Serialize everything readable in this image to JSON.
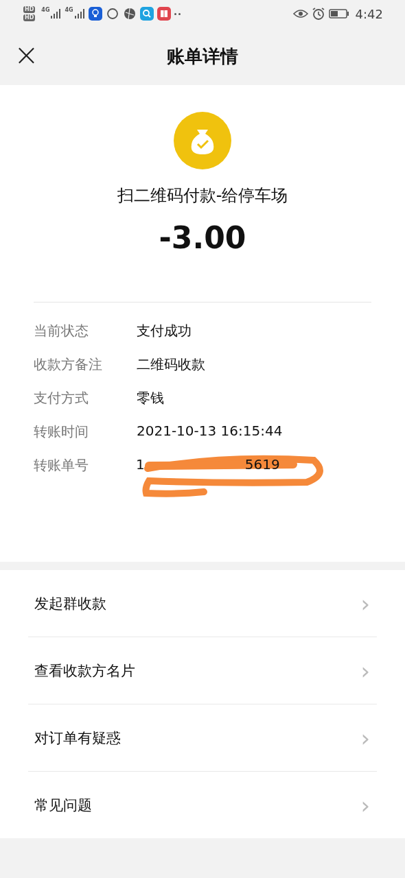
{
  "status_bar": {
    "sim_labels": [
      "HD",
      "HD"
    ],
    "network_labels": [
      "4G",
      "4G"
    ],
    "time": "4:42"
  },
  "header": {
    "close": "×",
    "title": "账单详情"
  },
  "payment": {
    "title": "扫二维码付款-给停车场",
    "amount": "-3.00"
  },
  "details": [
    {
      "label": "当前状态",
      "value": "支付成功"
    },
    {
      "label": "收款方备注",
      "value": "二维码收款"
    },
    {
      "label": "支付方式",
      "value": "零钱"
    },
    {
      "label": "转账时间",
      "value": "2021-10-13 16:15:44"
    }
  ],
  "order": {
    "label": "转账单号",
    "visible_start": "1",
    "visible_end": "5619"
  },
  "actions": [
    {
      "label": "发起群收款",
      "chevron": "›"
    },
    {
      "label": "查看收款方名片",
      "chevron": "›"
    },
    {
      "label": "对订单有疑惑",
      "chevron": "›"
    },
    {
      "label": "常见问题",
      "chevron": "›"
    }
  ]
}
